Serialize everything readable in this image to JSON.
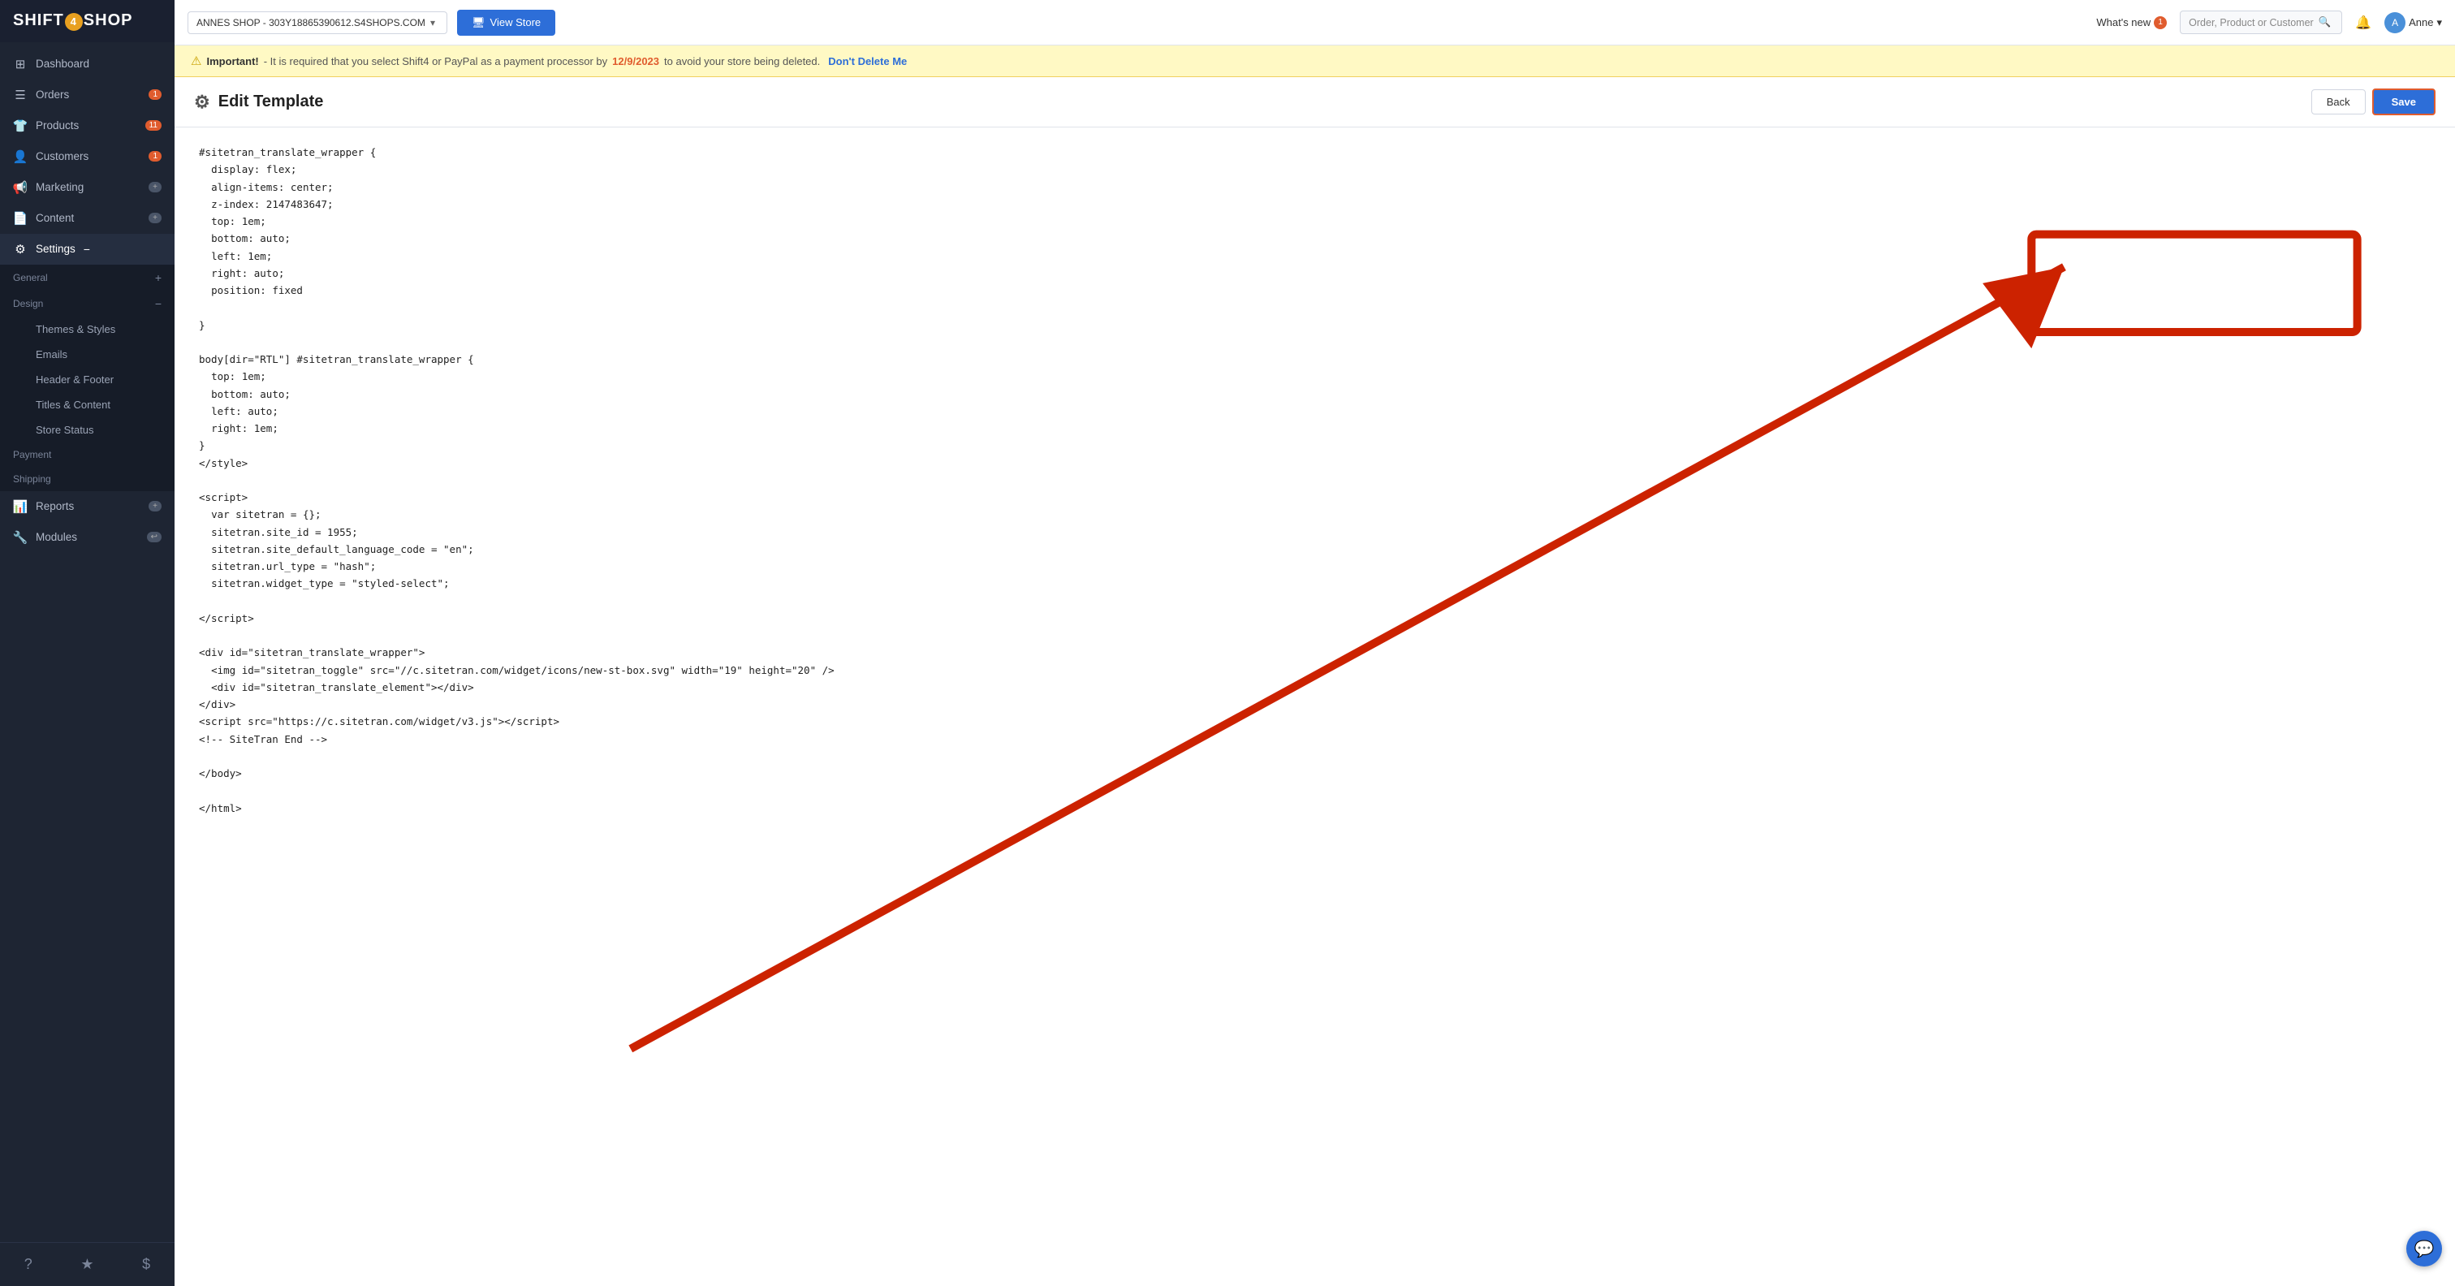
{
  "sidebar": {
    "logo": "SHIFT4SHOP",
    "logo_number": "4",
    "items": [
      {
        "id": "dashboard",
        "label": "Dashboard",
        "icon": "⊞",
        "badge": null,
        "active": false
      },
      {
        "id": "orders",
        "label": "Orders",
        "icon": "☰",
        "badge": "1",
        "active": false
      },
      {
        "id": "products",
        "label": "Products",
        "icon": "👕",
        "badge": "11",
        "active": false
      },
      {
        "id": "customers",
        "label": "Customers",
        "icon": "👤",
        "badge": "1",
        "active": false
      },
      {
        "id": "marketing",
        "label": "Marketing",
        "icon": "📢",
        "plus": true,
        "active": false
      },
      {
        "id": "content",
        "label": "Content",
        "icon": "📄",
        "plus": true,
        "active": false
      },
      {
        "id": "settings",
        "label": "Settings",
        "icon": "⚙",
        "expand": "−",
        "active": true
      }
    ],
    "settings_sections": [
      {
        "label": "General",
        "expand": "+",
        "items": []
      },
      {
        "label": "Design",
        "expand": "−",
        "items": [
          {
            "id": "themes-styles",
            "label": "Themes & Styles",
            "active": false
          },
          {
            "id": "emails",
            "label": "Emails",
            "active": false
          },
          {
            "id": "header-footer",
            "label": "Header & Footer",
            "active": false
          },
          {
            "id": "titles-content",
            "label": "Titles & Content",
            "active": false
          },
          {
            "id": "store-status",
            "label": "Store Status",
            "active": false
          }
        ]
      },
      {
        "label": "Payment",
        "expand": "",
        "items": []
      },
      {
        "label": "Shipping",
        "expand": "",
        "items": []
      }
    ],
    "other_items": [
      {
        "id": "reports",
        "label": "Reports",
        "icon": "📊",
        "plus": true
      },
      {
        "id": "modules",
        "label": "Modules",
        "icon": "🔧",
        "arrow": true
      }
    ],
    "bottom_icons": [
      "?",
      "★",
      "$"
    ]
  },
  "topbar": {
    "store_name": "ANNES SHOP - 303Y18865390612.S4SHOPS.COM",
    "view_store_label": "View Store",
    "view_store_icon": "🖥",
    "whats_new_label": "What's new",
    "whats_new_badge": "1",
    "search_placeholder": "Order, Product or Customer",
    "user_name": "Anne"
  },
  "alert": {
    "icon": "⚠",
    "bold": "Important!",
    "message": " - It is required that you select Shift4 or PayPal as a payment processor by ",
    "date": "12/9/2023",
    "message2": " to avoid your store being deleted.",
    "link_text": "Don't Delete Me"
  },
  "page": {
    "title": "Edit Template",
    "gear_icon": "⚙",
    "back_label": "Back",
    "save_label": "Save"
  },
  "code": {
    "content": "#sitetran_translate_wrapper {\n  display: flex;\n  align-items: center;\n  z-index: 2147483647;\n  top: 1em;\n  bottom: auto;\n  left: 1em;\n  right: auto;\n  position: fixed\n\n}\n\nbody[dir=\"RTL\"] #sitetran_translate_wrapper {\n  top: 1em;\n  bottom: auto;\n  left: auto;\n  right: 1em;\n}\n</style>\n\n<script>\n  var sitetran = {};\n  sitetran.site_id = 1955;\n  sitetran.site_default_language_code = \"en\";\n  sitetran.url_type = \"hash\";\n  sitetran.widget_type = \"styled-select\";\n\n</script>\n\n<div id=\"sitetran_translate_wrapper\">\n  <img id=\"sitetran_toggle\" src=\"//c.sitetran.com/widget/icons/new-st-box.svg\" width=\"19\" height=\"20\" />\n  <div id=\"sitetran_translate_element\"></div>\n</div>\n<script src=\"https://c.sitetran.com/widget/v3.js\"></script>\n<!-- SiteTran End -->\n\n</body>\n\n</html>"
  },
  "chat_bubble_icon": "💬"
}
